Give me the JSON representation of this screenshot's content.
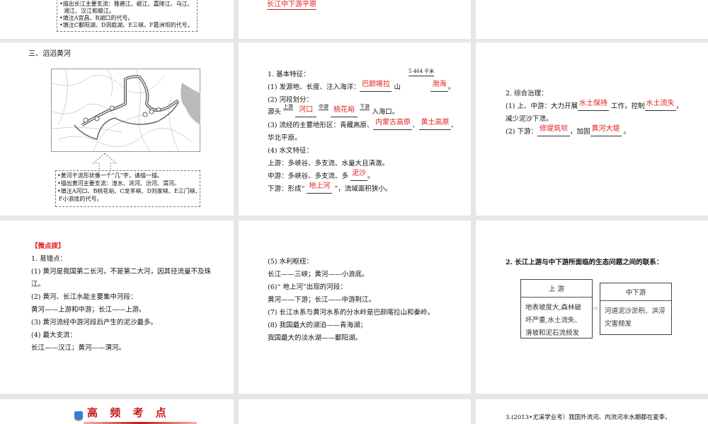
{
  "slides": {
    "top_left": {
      "lines": [
        "•描出长江主要支流：雅砻江、岷江、嘉陵江、乌江、",
        "湘江、汉江和赣江。",
        "•填注A宜昌、B湖口的代号。",
        "•填注C鄱阳湖、D洞庭湖、E三峡、F葛洲坝的代号。"
      ]
    },
    "top_middle": {
      "answer": "长江中下游平原"
    },
    "yellow_river_map": {
      "title": "三、滔滔黄河",
      "tasks": [
        "•黄河干流形状像一个“几”字，请描一描。",
        "•描出黄河主要支流：湟水、洮河、汾河、渭河。",
        "•填注A河口、B桃花峪、C龙羊峡、D刘家峡、E三门峡、",
        "F小浪底的代号。"
      ]
    },
    "basic_features": {
      "heading": "1. 基本特征：",
      "length": "5 464 千米",
      "l1_prefix": "(1) 发源地、长度、注入海洋：",
      "l1_a1": "巴颜喀拉",
      "l1_mid": "山",
      "l1_a2": "渤海",
      "l1_end": "。",
      "l2_prefix": "(2) 河段划分：",
      "source": "源头",
      "upper": "上游",
      "middle": "中游",
      "lower": "下游",
      "a_hekou": "河口",
      "a_taohuayu": "桃花峪",
      "sea": "入海口。",
      "l3_prefix": "(3) 流经的主要地形区：青藏高原、",
      "l3_a1": "内蒙古高原",
      "sep": "、",
      "l3_a2": "黄土高原",
      "l3_cont": "华北平原。",
      "l4": "(4) 水文特征：",
      "l4_upper": "上游：多峡谷、多支流、水量大且清澈。",
      "l4_mid_prefix": "中游：多峡谷、多支流、多",
      "l4_mid_a": "泥沙",
      "l4_low_prefix": "下游：形成“",
      "l4_low_a": "地上河",
      "l4_low_suffix": "”，流域面积狭小。"
    },
    "governance": {
      "heading": "2. 综合治理：",
      "l1_prefix": "(1) 上、中游：大力开展",
      "l1_a1": "水土保持",
      "l1_mid": "工作，控制",
      "l1_a2": "水土流失",
      "l1_end": "，",
      "l1_cont": "减少泥沙下泄。",
      "l2_prefix": "(2) 下游：",
      "l2_a1": "修堤筑坝",
      "l2_mid": "，加固",
      "l2_a2": "黄河大堤",
      "l2_end": "。"
    },
    "tips": {
      "heading": "【微点拨】",
      "lines": [
        "1. 易错点：",
        "(1) 黄河是我国第二长河，不是第二大河，因其径流量不及珠",
        "江。",
        "(2) 黄河、长江水能主要集中河段：",
        "黄河——上游和中游；长江——上游。",
        "(3) 黄河流经中游河段后产生的泥沙最多。",
        "(4) 最大支流：",
        "长江——汉江；黄河——渭河。"
      ]
    },
    "tips_cont": {
      "lines": [
        "(5) 水利枢纽：",
        "长江——三峡；黄河——小浪底。",
        "(6)“ 地上河”出现的河段：",
        "黄河——下游；长江——中游荆江。",
        "(7) 长江水系与黄河水系的分水岭是巴颜喀拉山和秦岭。",
        "(8) 我国最大的湖泊——青海湖；",
        "我国最大的淡水湖——鄱阳湖。"
      ]
    },
    "ecology": {
      "heading": "2. 长江上游与中下游所面临的生态问题之间的联系：",
      "upper_title": "上 游",
      "upper_body": "地表坡度大,森林破坏严重,水土流失、滑坡和泥石流频发",
      "lower_title": "中下游",
      "lower_body": "河道泥沙淤积、洪涝灾害频发"
    },
    "bottom_left": {
      "logo_text": "高 频 考 点"
    },
    "bottom_right": {
      "text": "3.(2013•尤溪学业考）我国外流河、内流河丰水期都在夏季，"
    }
  },
  "colors": {
    "accent_red": "#e0201c",
    "background": "#e6e6e6"
  }
}
